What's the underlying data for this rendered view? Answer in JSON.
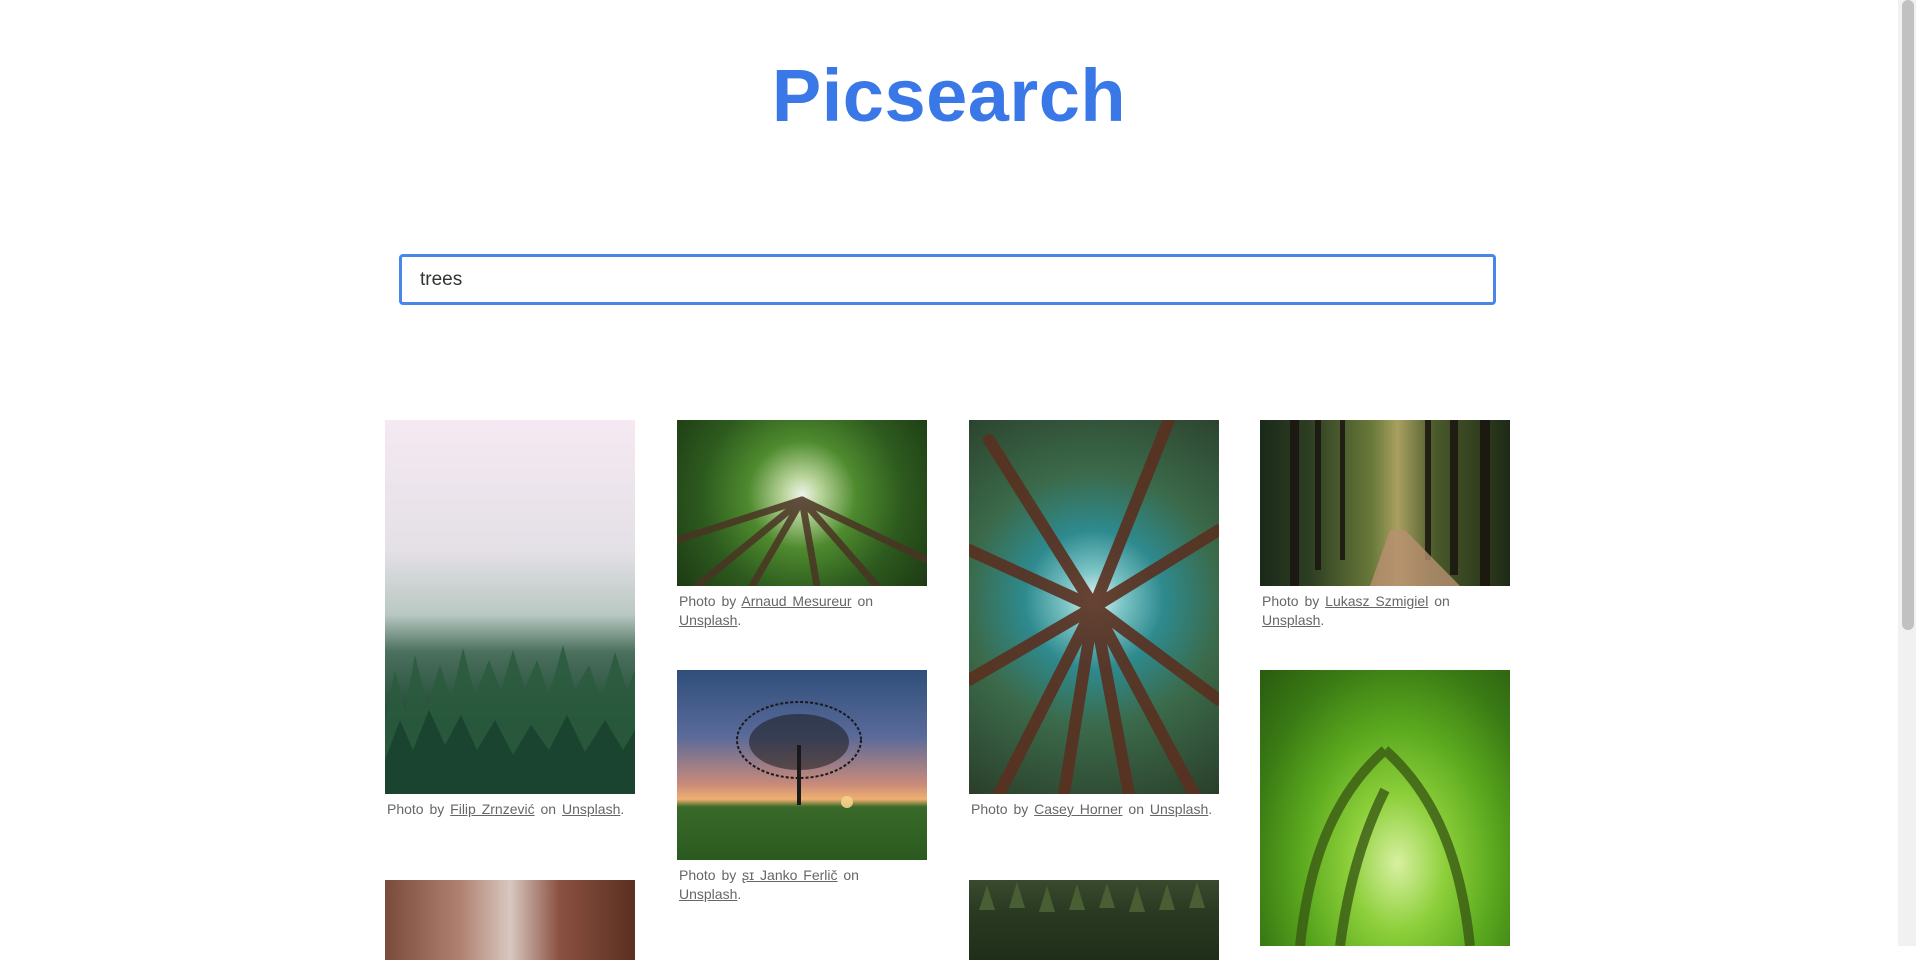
{
  "app": {
    "title": "Picsearch"
  },
  "search": {
    "value": "trees",
    "placeholder": ""
  },
  "caption_parts": {
    "prefix": "Photo by",
    "middle": "on",
    "source": "Unsplash",
    "suffix": "."
  },
  "photos": [
    {
      "author": "Filip Zrnzević",
      "subject": "misty-forest"
    },
    {
      "author": "Arnaud Mesureur",
      "subject": "tree-canopy"
    },
    {
      "author": "Casey Horner",
      "subject": "redwood-canopy"
    },
    {
      "author": "Lukasz Szmigiel",
      "subject": "forest-path"
    },
    {
      "author": "ʂɪ Janko Ferlič",
      "subject": "tree-sunset"
    },
    {
      "author": "",
      "subject": "redwood-trunks"
    },
    {
      "author": "",
      "subject": "green-tree-tunnel"
    },
    {
      "author": "",
      "subject": "pine-forest"
    }
  ]
}
